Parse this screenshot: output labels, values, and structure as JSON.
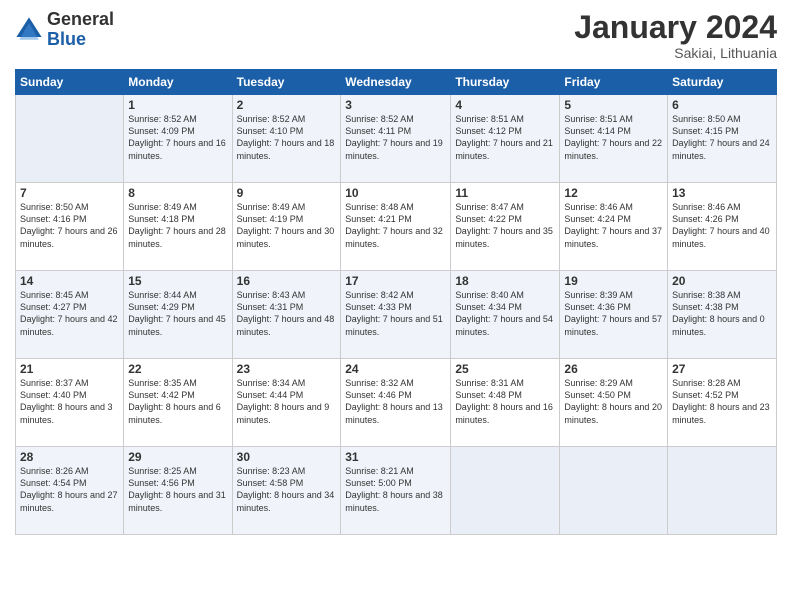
{
  "header": {
    "logo_general": "General",
    "logo_blue": "Blue",
    "month": "January 2024",
    "location": "Sakiai, Lithuania"
  },
  "days_of_week": [
    "Sunday",
    "Monday",
    "Tuesday",
    "Wednesday",
    "Thursday",
    "Friday",
    "Saturday"
  ],
  "weeks": [
    [
      {
        "day": "",
        "info": ""
      },
      {
        "day": "1",
        "info": "Sunrise: 8:52 AM\nSunset: 4:09 PM\nDaylight: 7 hours\nand 16 minutes."
      },
      {
        "day": "2",
        "info": "Sunrise: 8:52 AM\nSunset: 4:10 PM\nDaylight: 7 hours\nand 18 minutes."
      },
      {
        "day": "3",
        "info": "Sunrise: 8:52 AM\nSunset: 4:11 PM\nDaylight: 7 hours\nand 19 minutes."
      },
      {
        "day": "4",
        "info": "Sunrise: 8:51 AM\nSunset: 4:12 PM\nDaylight: 7 hours\nand 21 minutes."
      },
      {
        "day": "5",
        "info": "Sunrise: 8:51 AM\nSunset: 4:14 PM\nDaylight: 7 hours\nand 22 minutes."
      },
      {
        "day": "6",
        "info": "Sunrise: 8:50 AM\nSunset: 4:15 PM\nDaylight: 7 hours\nand 24 minutes."
      }
    ],
    [
      {
        "day": "7",
        "info": "Sunrise: 8:50 AM\nSunset: 4:16 PM\nDaylight: 7 hours\nand 26 minutes."
      },
      {
        "day": "8",
        "info": "Sunrise: 8:49 AM\nSunset: 4:18 PM\nDaylight: 7 hours\nand 28 minutes."
      },
      {
        "day": "9",
        "info": "Sunrise: 8:49 AM\nSunset: 4:19 PM\nDaylight: 7 hours\nand 30 minutes."
      },
      {
        "day": "10",
        "info": "Sunrise: 8:48 AM\nSunset: 4:21 PM\nDaylight: 7 hours\nand 32 minutes."
      },
      {
        "day": "11",
        "info": "Sunrise: 8:47 AM\nSunset: 4:22 PM\nDaylight: 7 hours\nand 35 minutes."
      },
      {
        "day": "12",
        "info": "Sunrise: 8:46 AM\nSunset: 4:24 PM\nDaylight: 7 hours\nand 37 minutes."
      },
      {
        "day": "13",
        "info": "Sunrise: 8:46 AM\nSunset: 4:26 PM\nDaylight: 7 hours\nand 40 minutes."
      }
    ],
    [
      {
        "day": "14",
        "info": "Sunrise: 8:45 AM\nSunset: 4:27 PM\nDaylight: 7 hours\nand 42 minutes."
      },
      {
        "day": "15",
        "info": "Sunrise: 8:44 AM\nSunset: 4:29 PM\nDaylight: 7 hours\nand 45 minutes."
      },
      {
        "day": "16",
        "info": "Sunrise: 8:43 AM\nSunset: 4:31 PM\nDaylight: 7 hours\nand 48 minutes."
      },
      {
        "day": "17",
        "info": "Sunrise: 8:42 AM\nSunset: 4:33 PM\nDaylight: 7 hours\nand 51 minutes."
      },
      {
        "day": "18",
        "info": "Sunrise: 8:40 AM\nSunset: 4:34 PM\nDaylight: 7 hours\nand 54 minutes."
      },
      {
        "day": "19",
        "info": "Sunrise: 8:39 AM\nSunset: 4:36 PM\nDaylight: 7 hours\nand 57 minutes."
      },
      {
        "day": "20",
        "info": "Sunrise: 8:38 AM\nSunset: 4:38 PM\nDaylight: 8 hours\nand 0 minutes."
      }
    ],
    [
      {
        "day": "21",
        "info": "Sunrise: 8:37 AM\nSunset: 4:40 PM\nDaylight: 8 hours\nand 3 minutes."
      },
      {
        "day": "22",
        "info": "Sunrise: 8:35 AM\nSunset: 4:42 PM\nDaylight: 8 hours\nand 6 minutes."
      },
      {
        "day": "23",
        "info": "Sunrise: 8:34 AM\nSunset: 4:44 PM\nDaylight: 8 hours\nand 9 minutes."
      },
      {
        "day": "24",
        "info": "Sunrise: 8:32 AM\nSunset: 4:46 PM\nDaylight: 8 hours\nand 13 minutes."
      },
      {
        "day": "25",
        "info": "Sunrise: 8:31 AM\nSunset: 4:48 PM\nDaylight: 8 hours\nand 16 minutes."
      },
      {
        "day": "26",
        "info": "Sunrise: 8:29 AM\nSunset: 4:50 PM\nDaylight: 8 hours\nand 20 minutes."
      },
      {
        "day": "27",
        "info": "Sunrise: 8:28 AM\nSunset: 4:52 PM\nDaylight: 8 hours\nand 23 minutes."
      }
    ],
    [
      {
        "day": "28",
        "info": "Sunrise: 8:26 AM\nSunset: 4:54 PM\nDaylight: 8 hours\nand 27 minutes."
      },
      {
        "day": "29",
        "info": "Sunrise: 8:25 AM\nSunset: 4:56 PM\nDaylight: 8 hours\nand 31 minutes."
      },
      {
        "day": "30",
        "info": "Sunrise: 8:23 AM\nSunset: 4:58 PM\nDaylight: 8 hours\nand 34 minutes."
      },
      {
        "day": "31",
        "info": "Sunrise: 8:21 AM\nSunset: 5:00 PM\nDaylight: 8 hours\nand 38 minutes."
      },
      {
        "day": "",
        "info": ""
      },
      {
        "day": "",
        "info": ""
      },
      {
        "day": "",
        "info": ""
      }
    ]
  ]
}
